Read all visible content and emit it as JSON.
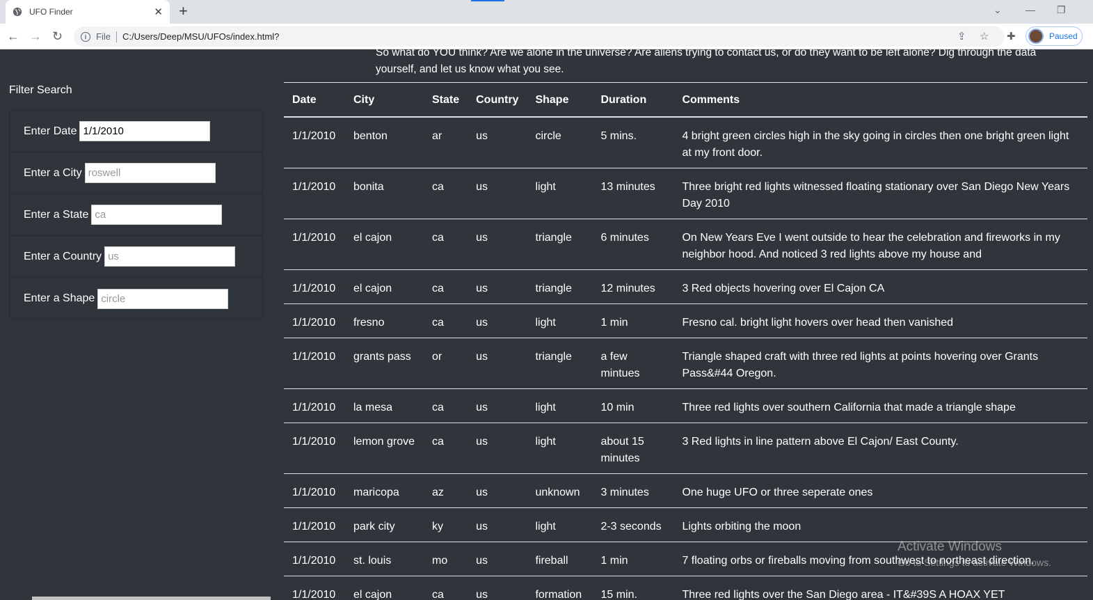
{
  "browser": {
    "tab_title": "UFO Finder",
    "new_tab_label": "+",
    "address_scheme": "File",
    "address_url": "C:/Users/Deep/MSU/UFOs/index.html?",
    "profile_status": "Paused"
  },
  "page": {
    "intro_line1": "So what do YOU think? Are we alone in the universe? Are aliens trying to contact us, or do they want to be left alone? Dig through the data",
    "intro_line2": "yourself, and let us know what you see."
  },
  "sidebar": {
    "title": "Filter Search",
    "filters": [
      {
        "label": "Enter Date",
        "value": "1/1/2010",
        "placeholder": ""
      },
      {
        "label": "Enter a City",
        "value": "",
        "placeholder": "roswell"
      },
      {
        "label": "Enter a State",
        "value": "",
        "placeholder": "ca"
      },
      {
        "label": "Enter a Country",
        "value": "",
        "placeholder": "us"
      },
      {
        "label": "Enter a Shape",
        "value": "",
        "placeholder": "circle"
      }
    ]
  },
  "table": {
    "headers": [
      "Date",
      "City",
      "State",
      "Country",
      "Shape",
      "Duration",
      "Comments"
    ],
    "rows": [
      [
        "1/1/2010",
        "benton",
        "ar",
        "us",
        "circle",
        "5 mins.",
        "4 bright green circles high in the sky going in circles then one bright green light at my front door."
      ],
      [
        "1/1/2010",
        "bonita",
        "ca",
        "us",
        "light",
        "13 minutes",
        "Three bright red lights witnessed floating stationary over San Diego New Years Day 2010"
      ],
      [
        "1/1/2010",
        "el cajon",
        "ca",
        "us",
        "triangle",
        "6 minutes",
        "On New Years Eve I went outside to hear the celebration and fireworks in my neighbor hood. And noticed 3 red lights above my house and"
      ],
      [
        "1/1/2010",
        "el cajon",
        "ca",
        "us",
        "triangle",
        "12 minutes",
        "3 Red objects hovering over El Cajon CA"
      ],
      [
        "1/1/2010",
        "fresno",
        "ca",
        "us",
        "light",
        "1 min",
        "Fresno cal. bright light hovers over head then vanished"
      ],
      [
        "1/1/2010",
        "grants pass",
        "or",
        "us",
        "triangle",
        "a few mintues",
        "Triangle shaped craft with three red lights at points hovering over Grants Pass&#44 Oregon."
      ],
      [
        "1/1/2010",
        "la mesa",
        "ca",
        "us",
        "light",
        "10 min",
        "Three red lights over southern California that made a triangle shape"
      ],
      [
        "1/1/2010",
        "lemon grove",
        "ca",
        "us",
        "light",
        "about 15 minutes",
        "3 Red lights in line pattern above El Cajon/ East County."
      ],
      [
        "1/1/2010",
        "maricopa",
        "az",
        "us",
        "unknown",
        "3 minutes",
        "One huge UFO or three seperate ones"
      ],
      [
        "1/1/2010",
        "park city",
        "ky",
        "us",
        "light",
        "2-3 seconds",
        "Lights orbiting the moon"
      ],
      [
        "1/1/2010",
        "st. louis",
        "mo",
        "us",
        "fireball",
        "1 min",
        "7 floating orbs or fireballs moving from southwest to northeast direction."
      ],
      [
        "1/1/2010",
        "el cajon",
        "ca",
        "us",
        "formation",
        "15 min.",
        "Three red lights over the San Diego area - IT&#39S A HOAX YET"
      ]
    ]
  },
  "watermark": {
    "line1": "Activate Windows",
    "line2": "Go to Settings to activate Windows."
  }
}
